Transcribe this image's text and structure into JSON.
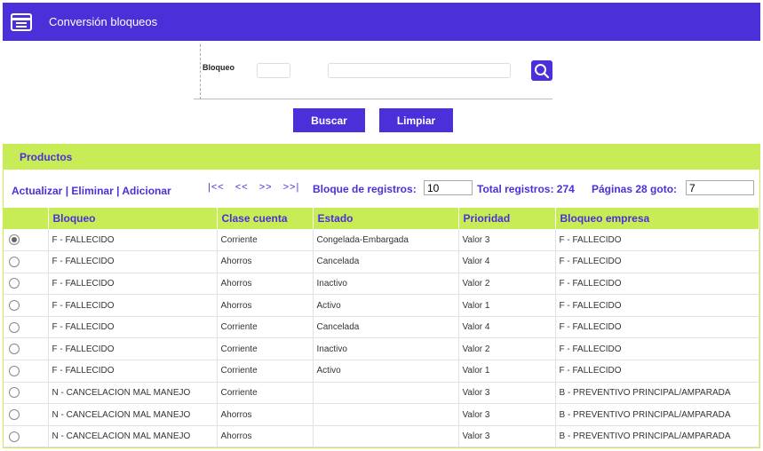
{
  "header": {
    "title": "Conversión bloqueos",
    "icon": "form-icon"
  },
  "filter": {
    "label": "Bloqueo",
    "code_value": "",
    "desc_value": "",
    "search_icon": "search-icon"
  },
  "buttons": {
    "buscar": "Buscar",
    "limpiar": "Limpiar"
  },
  "panel": {
    "title": "Productos",
    "actions": [
      "Actualizar",
      "Eliminar",
      "Adicionar"
    ],
    "action_sep": "|",
    "pager": [
      "|<<",
      "<<",
      ">>",
      ">>|"
    ],
    "block_label": "Bloque de registros:",
    "block_value": "10",
    "total_label": "Total registros: 274",
    "pages_label": "Páginas 28 goto:",
    "goto_value": "7"
  },
  "table": {
    "columns": [
      "Bloqueo",
      "Clase cuenta",
      "Estado",
      "Prioridad",
      "Bloqueo empresa"
    ],
    "rows": [
      {
        "selected": true,
        "cells": [
          "F - FALLECIDO",
          "Corriente",
          "Congelada-Embargada",
          "Valor 3",
          "F - FALLECIDO"
        ]
      },
      {
        "selected": false,
        "cells": [
          "F - FALLECIDO",
          "Ahorros",
          "Cancelada",
          "Valor 4",
          "F - FALLECIDO"
        ]
      },
      {
        "selected": false,
        "cells": [
          "F - FALLECIDO",
          "Ahorros",
          "Inactivo",
          "Valor 2",
          "F - FALLECIDO"
        ]
      },
      {
        "selected": false,
        "cells": [
          "F - FALLECIDO",
          "Ahorros",
          "Activo",
          "Valor 1",
          "F - FALLECIDO"
        ]
      },
      {
        "selected": false,
        "cells": [
          "F - FALLECIDO",
          "Corriente",
          "Cancelada",
          "Valor 4",
          "F - FALLECIDO"
        ]
      },
      {
        "selected": false,
        "cells": [
          "F - FALLECIDO",
          "Corriente",
          "Inactivo",
          "Valor 2",
          "F - FALLECIDO"
        ]
      },
      {
        "selected": false,
        "cells": [
          "F - FALLECIDO",
          "Corriente",
          "Activo",
          "Valor 1",
          "F - FALLECIDO"
        ]
      },
      {
        "selected": false,
        "cells": [
          "N - CANCELACION MAL MANEJO",
          "Corriente",
          "",
          "Valor 3",
          "B - PREVENTIVO PRINCIPAL/AMPARADA"
        ]
      },
      {
        "selected": false,
        "cells": [
          "N - CANCELACION MAL MANEJO",
          "Ahorros",
          "",
          "Valor 3",
          "B - PREVENTIVO PRINCIPAL/AMPARADA"
        ]
      },
      {
        "selected": false,
        "cells": [
          "N - CANCELACION MAL MANEJO",
          "Ahorros",
          "",
          "Valor 3",
          "B - PREVENTIVO PRINCIPAL/AMPARADA"
        ]
      }
    ]
  },
  "colors": {
    "accent": "#4b2fd9",
    "panel_header": "#c8ec55"
  }
}
